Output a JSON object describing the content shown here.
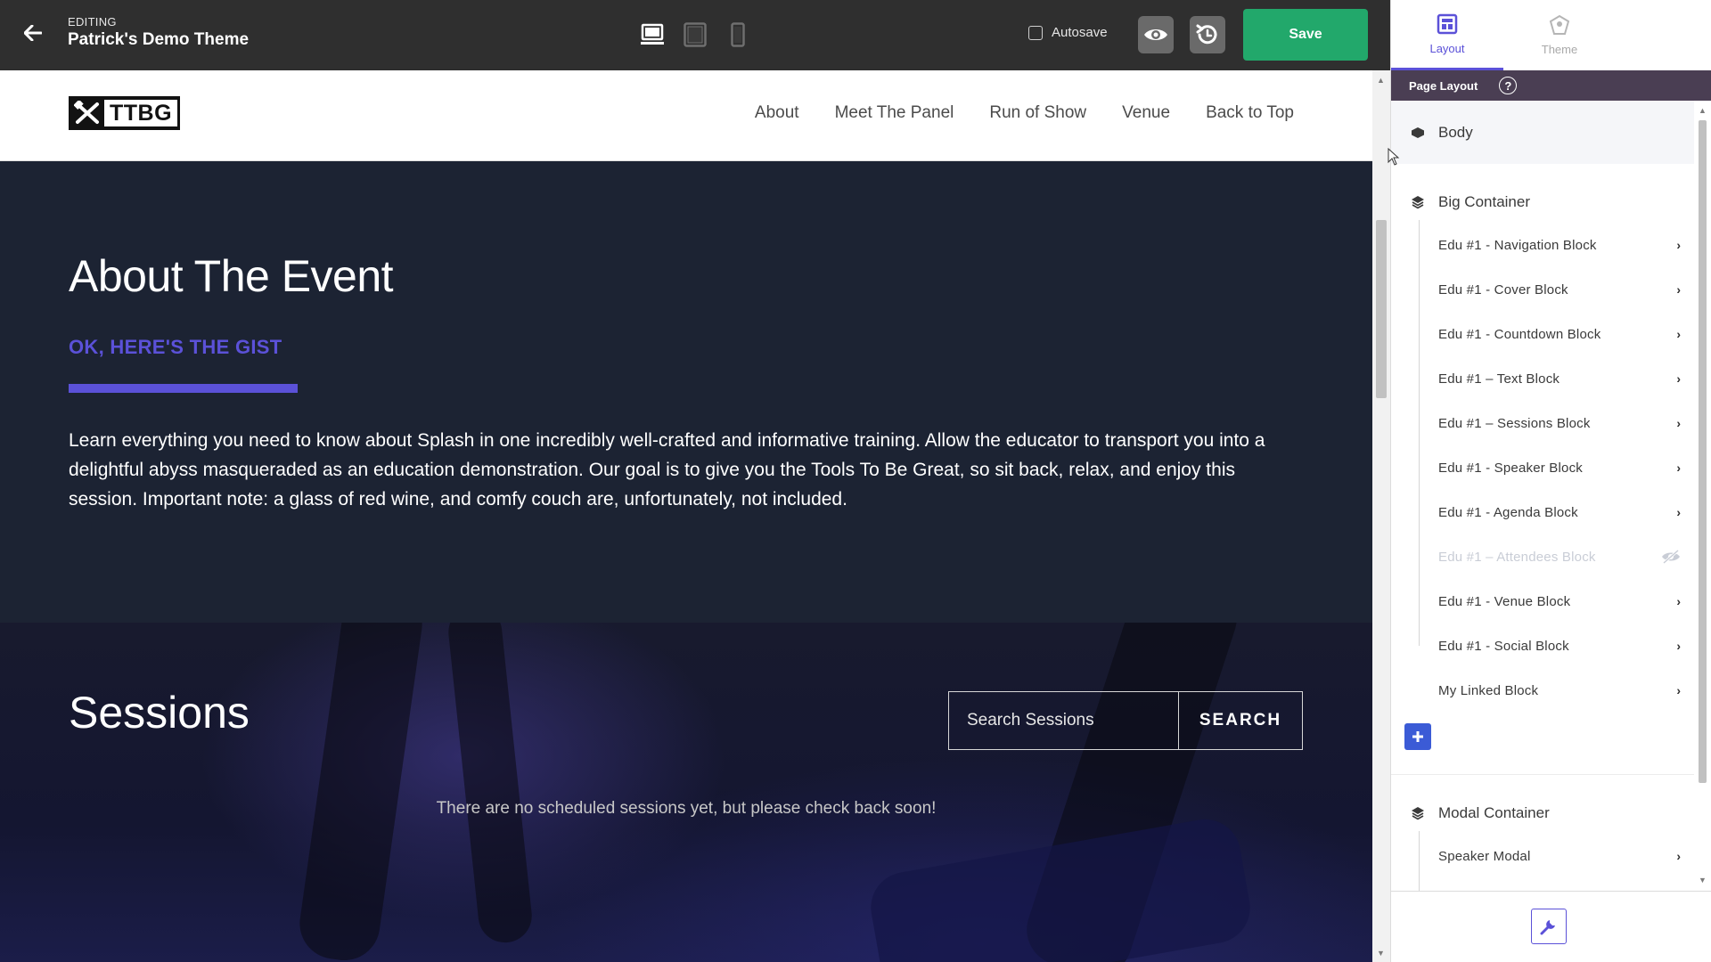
{
  "editor": {
    "editing_label": "EDITING",
    "theme_name": "Patrick's Demo Theme",
    "autosave_label": "Autosave",
    "autosave_checked": false,
    "save_label": "Save",
    "devices": [
      "desktop-icon",
      "tablet-icon",
      "mobile-icon"
    ]
  },
  "site": {
    "logo_text": "TTBG",
    "menu": [
      "About",
      "Meet The Panel",
      "Run of Show",
      "Venue",
      "Back to Top"
    ]
  },
  "about": {
    "title": "About The Event",
    "subtitle": "OK, HERE'S THE GIST",
    "body": "Learn everything you need to know about Splash in one incredibly well-crafted and informative training. Allow the educator to transport you into a delightful abyss masqueraded as an education demonstration. Our goal is to give you the Tools To Be Great, so sit back, relax, and enjoy this session. Important note: a glass of red wine, and comfy couch are, unfortunately, not included."
  },
  "sessions": {
    "title": "Sessions",
    "search_placeholder": "Search Sessions",
    "search_button": "SEARCH",
    "empty_text": "There are no scheduled sessions yet, but please check back soon!"
  },
  "sidebar": {
    "tabs": [
      {
        "label": "Layout",
        "icon": "layout-icon",
        "active": true
      },
      {
        "label": "Theme",
        "icon": "theme-icon",
        "active": false
      }
    ],
    "header_title": "Page Layout",
    "help_glyph": "?",
    "body_label": "Body",
    "big_container": {
      "label": "Big Container",
      "items": [
        {
          "label": "Edu #1 - Navigation Block",
          "hidden": false
        },
        {
          "label": "Edu #1 - Cover Block",
          "hidden": false
        },
        {
          "label": "Edu #1 - Countdown Block",
          "hidden": false
        },
        {
          "label": "Edu #1 – Text Block",
          "hidden": false
        },
        {
          "label": "Edu #1 – Sessions Block",
          "hidden": false
        },
        {
          "label": "Edu #1 - Speaker Block",
          "hidden": false
        },
        {
          "label": "Edu #1 - Agenda Block",
          "hidden": false
        },
        {
          "label": "Edu #1 – Attendees Block",
          "hidden": true
        },
        {
          "label": "Edu #1 - Venue Block",
          "hidden": false
        },
        {
          "label": "Edu #1 - Social Block",
          "hidden": false
        },
        {
          "label": "My Linked Block",
          "hidden": false
        }
      ]
    },
    "modal_container": {
      "label": "Modal Container",
      "items": [
        {
          "label": "Speaker Modal",
          "hidden": false
        }
      ]
    }
  },
  "colors": {
    "accent": "#5b51d8",
    "save_green": "#22a86b",
    "topbar": "#2f2f2f",
    "section_dark": "#1c2333",
    "sidebar_header": "#4a3e53"
  }
}
